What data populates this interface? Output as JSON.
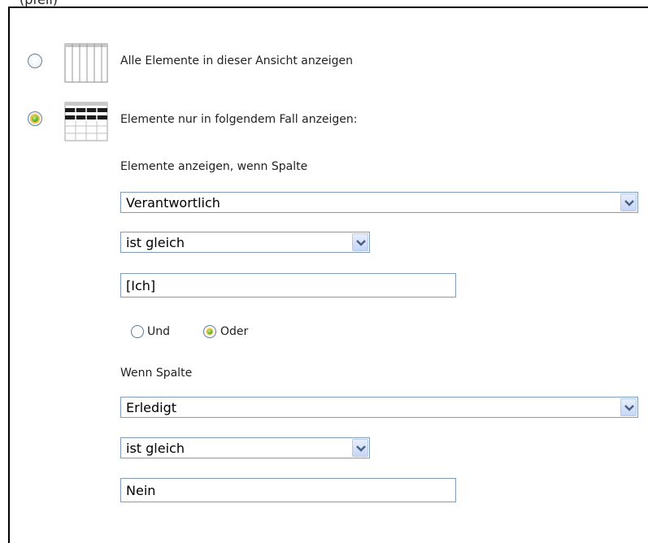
{
  "caption": "(pfeil)",
  "option_all": {
    "label": "Alle Elemente in dieser Ansicht anzeigen",
    "selected": false
  },
  "option_filter": {
    "label": "Elemente nur in folgendem Fall anzeigen:",
    "selected": true
  },
  "filter1": {
    "label": "Elemente anzeigen, wenn Spalte",
    "column": "Verantwortlich",
    "operator": "ist gleich",
    "value": "[Ich]"
  },
  "logic": {
    "und_label": "Und",
    "oder_label": "Oder",
    "selected": "Oder"
  },
  "filter2": {
    "label": "Wenn Spalte",
    "column": "Erledigt",
    "operator": "ist gleich",
    "value": "Nein"
  },
  "icons": {
    "grid_all": "table-grid-icon",
    "grid_filter": "filtered-table-icon",
    "dropdown": "chevron-down-icon"
  },
  "colors": {
    "input_border": "#7f9db9",
    "radio_dot": "#3f9c1a",
    "radio_ring": "#f4c343"
  }
}
